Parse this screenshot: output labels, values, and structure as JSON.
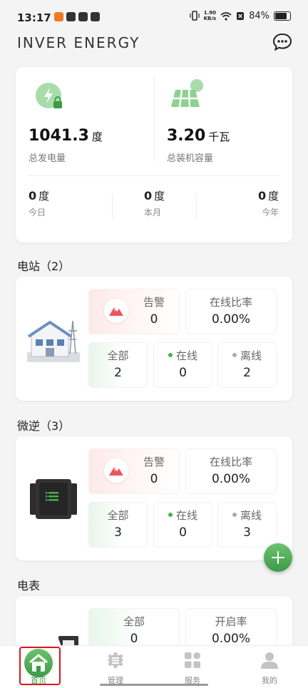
{
  "status_bar": {
    "time": "13:17",
    "speed_value": "1.90",
    "speed_unit": "KB/s",
    "battery": "84%"
  },
  "header": {
    "brand": "INVER ENERGY"
  },
  "summary": {
    "total_generation": {
      "value": "1041.3",
      "unit": "度",
      "label": "总发电量"
    },
    "installed_capacity": {
      "value": "3.20",
      "unit": "千瓦",
      "label": "总装机容量"
    },
    "periods": [
      {
        "value": "0",
        "unit": "度",
        "label": "今日"
      },
      {
        "value": "0",
        "unit": "度",
        "label": "本月"
      },
      {
        "value": "0",
        "unit": "度",
        "label": "今年"
      }
    ]
  },
  "stations": {
    "title": "电站（2）",
    "alarm_label": "告警",
    "alarm_value": "0",
    "rate_label": "在线比率",
    "rate_value": "0.00%",
    "all_label": "全部",
    "all_value": "2",
    "online_label": "在线",
    "online_value": "0",
    "offline_label": "离线",
    "offline_value": "2"
  },
  "microinverters": {
    "title": "微逆（3）",
    "alarm_label": "告警",
    "alarm_value": "0",
    "rate_label": "在线比率",
    "rate_value": "0.00%",
    "all_label": "全部",
    "all_value": "3",
    "online_label": "在线",
    "online_value": "0",
    "offline_label": "离线",
    "offline_value": "3"
  },
  "meters": {
    "title": "电表",
    "all_label": "全部",
    "all_value": "0",
    "rate_label": "开启率",
    "rate_value": "0.00%"
  },
  "tabs": [
    {
      "label": "首页",
      "icon": "home-icon"
    },
    {
      "label": "管理",
      "icon": "gear-icon"
    },
    {
      "label": "服务",
      "icon": "grid-icon"
    },
    {
      "label": "我的",
      "icon": "user-icon"
    }
  ],
  "colors": {
    "accent_green": "#3d9b46",
    "alarm_red": "#e85a5a",
    "highlight_border": "#d9161c"
  }
}
